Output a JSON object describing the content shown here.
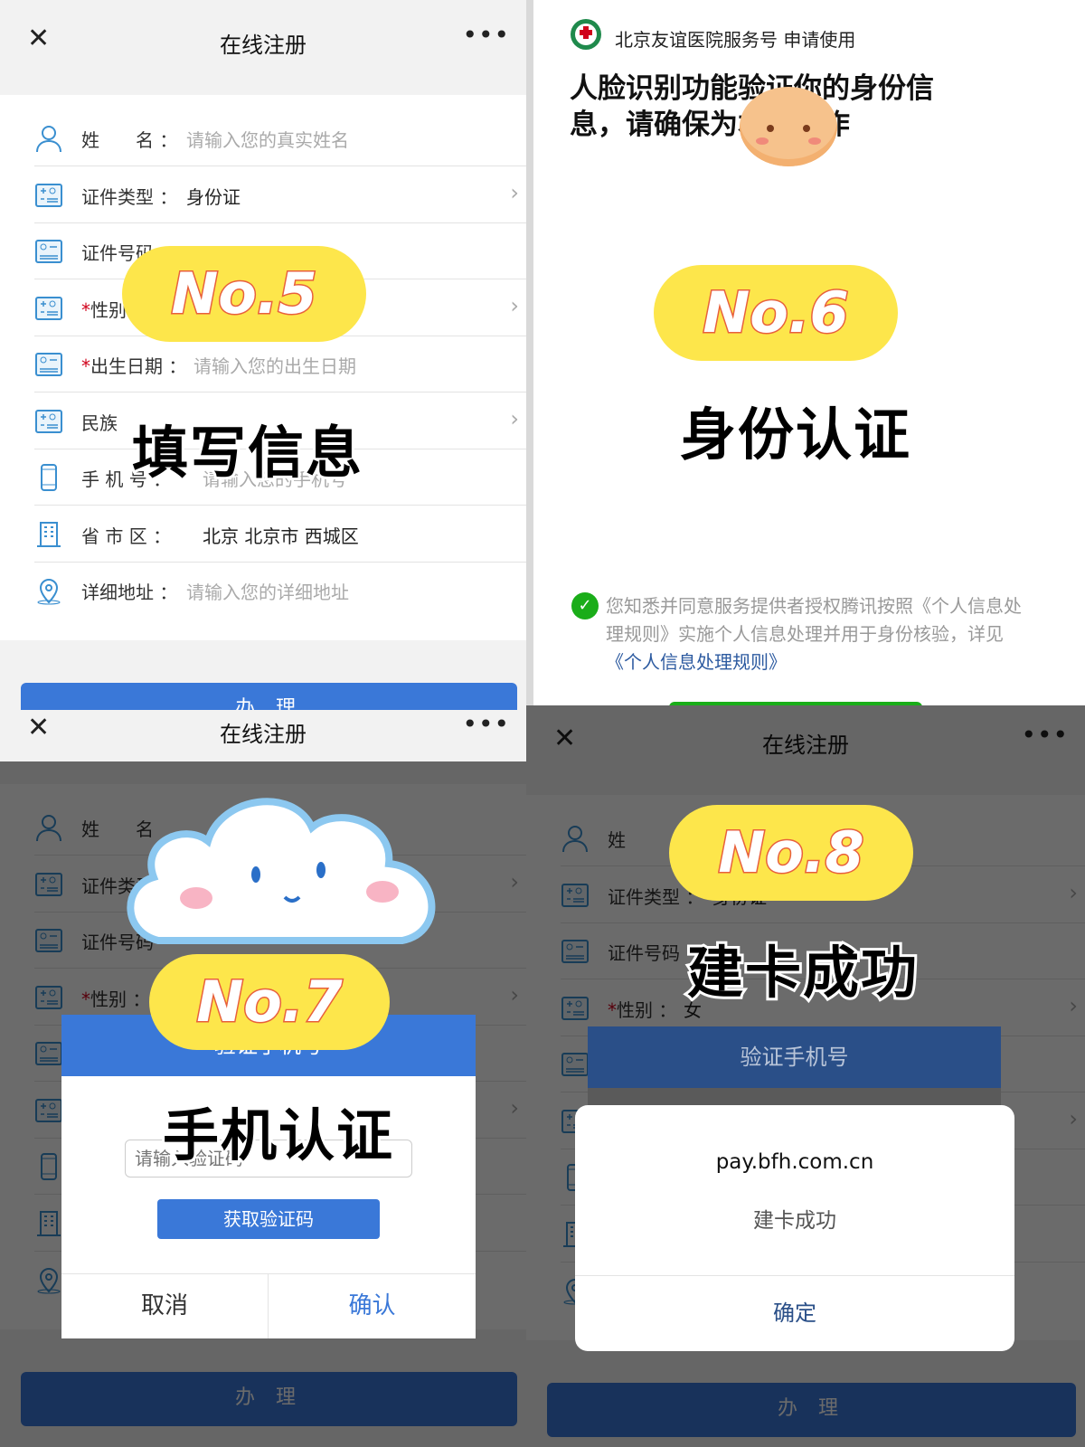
{
  "colors": {
    "accent": "#3a78d8",
    "sticker": "#fde64b",
    "sticker_stroke": "#e8603c",
    "check": "#1aad19",
    "link": "#2c5aa0"
  },
  "header": {
    "close_icon": "close-icon",
    "title": "在线注册",
    "more_icon": "more-dots-icon",
    "close": "✕",
    "more": "•••"
  },
  "forms": [
    {
      "rows": [
        {
          "icon": "person",
          "label": "姓　　名",
          "sep": "：",
          "value": "请输入您的真实姓名",
          "ph": true
        },
        {
          "icon": "card-plus",
          "label": "证件类型",
          "sep": "：",
          "value": "身份证",
          "chev": true
        },
        {
          "icon": "card-id",
          "label": "证件号码",
          "sep": "",
          "value": ""
        },
        {
          "icon": "card-plus",
          "label": "性别",
          "req": true,
          "sep": "",
          "value": "",
          "chev": true
        },
        {
          "icon": "card-id",
          "label": "出生日期",
          "req": true,
          "sep": "：",
          "value": "请输入您的出生日期",
          "ph": true
        },
        {
          "icon": "card-plus",
          "label": "民族",
          "sep": "",
          "value": "",
          "chev": true
        },
        {
          "icon": "phone",
          "label": "手 机 号",
          "sep": "：",
          "value": "请输入您的手机号",
          "ph": true
        },
        {
          "icon": "building",
          "label": "省 市 区",
          "sep": "：",
          "value": "北京 北京市 西城区"
        },
        {
          "icon": "location",
          "label": "详细地址",
          "sep": "：",
          "value": "请输入您的详细地址",
          "ph": true
        }
      ],
      "submit": "办 理"
    },
    {
      "rows": [
        {
          "icon": "person",
          "label": "姓　　名",
          "sep": "",
          "value": ""
        },
        {
          "icon": "card-plus",
          "label": "证件类型",
          "sep": "",
          "value": "",
          "chev": true
        },
        {
          "icon": "card-id",
          "label": "证件号码",
          "sep": "",
          "value": ""
        },
        {
          "icon": "card-plus",
          "label": "性别",
          "req": true,
          "sep": "：",
          "value": "",
          "chev": true
        },
        {
          "icon": "card-id",
          "label": "",
          "sep": "",
          "value": ""
        },
        {
          "icon": "card-plus",
          "label": "",
          "sep": "",
          "value": "",
          "chev": true
        },
        {
          "icon": "phone",
          "label": "",
          "sep": "",
          "value": ""
        },
        {
          "icon": "building",
          "label": "",
          "sep": "",
          "value": ""
        },
        {
          "icon": "location",
          "label": "",
          "sep": "",
          "value": ""
        }
      ],
      "submit": "办 理"
    },
    {
      "rows": [
        {
          "icon": "person",
          "label": "姓",
          "sep": "",
          "value": ""
        },
        {
          "icon": "card-plus",
          "label": "证件类型",
          "sep": "：",
          "value": "身份证",
          "chev": true
        },
        {
          "icon": "card-id",
          "label": "证件号码",
          "sep": "",
          "value": ""
        },
        {
          "icon": "card-plus",
          "label": "性别",
          "req": true,
          "sep": "：",
          "value": "女",
          "chev": true
        },
        {
          "icon": "card-id",
          "label": "",
          "sep": "",
          "value": ""
        },
        {
          "icon": "card-plus",
          "label": "",
          "sep": "",
          "value": "",
          "chev": true
        },
        {
          "icon": "phone",
          "label": "",
          "sep": "",
          "value": ""
        },
        {
          "icon": "building",
          "label": "",
          "sep": "",
          "value": ""
        },
        {
          "icon": "location",
          "label": "",
          "sep": "",
          "value": ""
        }
      ],
      "submit": "办 理"
    }
  ],
  "stickers": {
    "no5": "No.5",
    "step5": "填写信息",
    "no6": "No.6",
    "step6": "身份认证",
    "no7": "No.7",
    "step7": "手机认证",
    "no8": "No.8",
    "step8": "建卡成功"
  },
  "face": {
    "account": "北京友谊医院服务号 申请使用",
    "heading": "人脸识别功能验证你的身份信息，请确保为本人操作",
    "consent": "您知悉并同意服务提供者授权腾讯按照《个人信息处理规则》实施个人信息处理并用于身份核验，详见",
    "consent_link": "《个人信息处理规则》"
  },
  "verify_dialog": {
    "title": "验证手机号",
    "code_placeholder": "请输入验证码",
    "get_code": "获取验证码",
    "cancel": "取消",
    "confirm": "确认"
  },
  "alert": {
    "domain": "pay.bfh.com.cn",
    "message": "建卡成功",
    "ok": "确定",
    "behind_title": "验证手机号"
  }
}
